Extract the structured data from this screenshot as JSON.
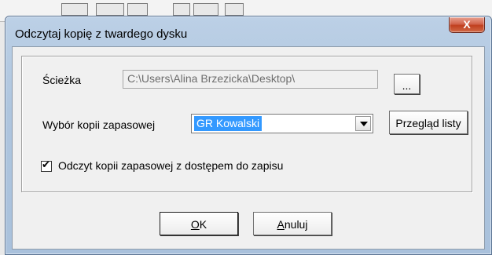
{
  "dialog": {
    "title": "Odczytaj kopię z twardego dysku",
    "close_label": "X"
  },
  "path": {
    "label": "Ścieżka",
    "value": "C:\\Users\\Alina Brzezicka\\Desktop\\",
    "browse_label": "..."
  },
  "backup": {
    "label": "Wybór kopii zapasowej",
    "selected": "GR Kowalski",
    "preview_label": "Przegląd listy"
  },
  "write_access": {
    "label": "Odczyt kopii zapasowej z dostępem do zapisu",
    "checked": true,
    "mark": "✔"
  },
  "buttons": {
    "ok_mnemonic": "O",
    "ok_rest": "K",
    "cancel_mnemonic": "A",
    "cancel_rest": "nuluj"
  }
}
